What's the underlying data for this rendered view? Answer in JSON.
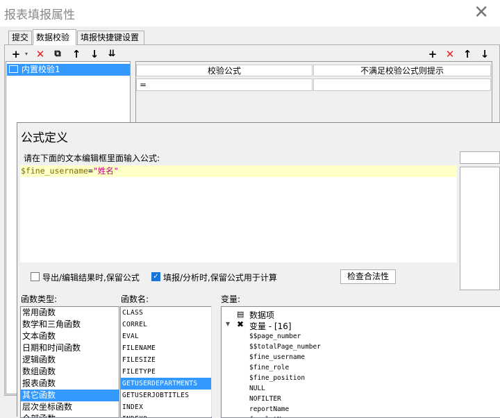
{
  "window": {
    "title": "报表填报属性",
    "close": "✕"
  },
  "tabs": [
    {
      "label": "提交"
    },
    {
      "label": "数据校验"
    },
    {
      "label": "填报快捷键设置"
    }
  ],
  "left_list": {
    "items": [
      "内置校验1"
    ]
  },
  "validation_table": {
    "headers": [
      "校验公式",
      "不满足校验公式则提示"
    ],
    "rows": [
      [
        "=",
        ""
      ]
    ]
  },
  "formula_dialog": {
    "title": "公式定义",
    "prompt": "请在下面的文本编辑框里面输入公式:",
    "code_var": "$fine_username",
    "code_eq": "=",
    "code_str": "\"姓名\"",
    "checkbox1_label": "导出/编辑结果时,保留公式",
    "checkbox2_label": "填报/分析时,保留公式用于计算",
    "check_button": "检查合法性",
    "func_type_label": "函数类型:",
    "func_name_label": "函数名:",
    "var_label": "变量:",
    "func_types": [
      "常用函数",
      "数学和三角函数",
      "文本函数",
      "日期和时间函数",
      "逻辑函数",
      "数组函数",
      "报表函数",
      "其它函数",
      "层次坐标函数",
      "全部函数"
    ],
    "func_names": [
      "CLASS",
      "CORREL",
      "EVAL",
      "FILENAME",
      "FILESIZE",
      "FILETYPE",
      "GETUSERDEPARTMENTS",
      "GETUSERJOBTITLES",
      "INDEX",
      "INDEXO"
    ],
    "vars_group1": "数据项",
    "vars_group2": "变量 - [16]",
    "vars": [
      "$$page_number",
      "$$totalPage_number",
      "$fine_username",
      "$fine_role",
      "$fine_position",
      "NULL",
      "NOFILTER",
      "reportName",
      "formletN"
    ]
  },
  "colors": {
    "selection": "#3399ff",
    "editor_line": "#ffffc8",
    "delete_red": "#e02020"
  }
}
